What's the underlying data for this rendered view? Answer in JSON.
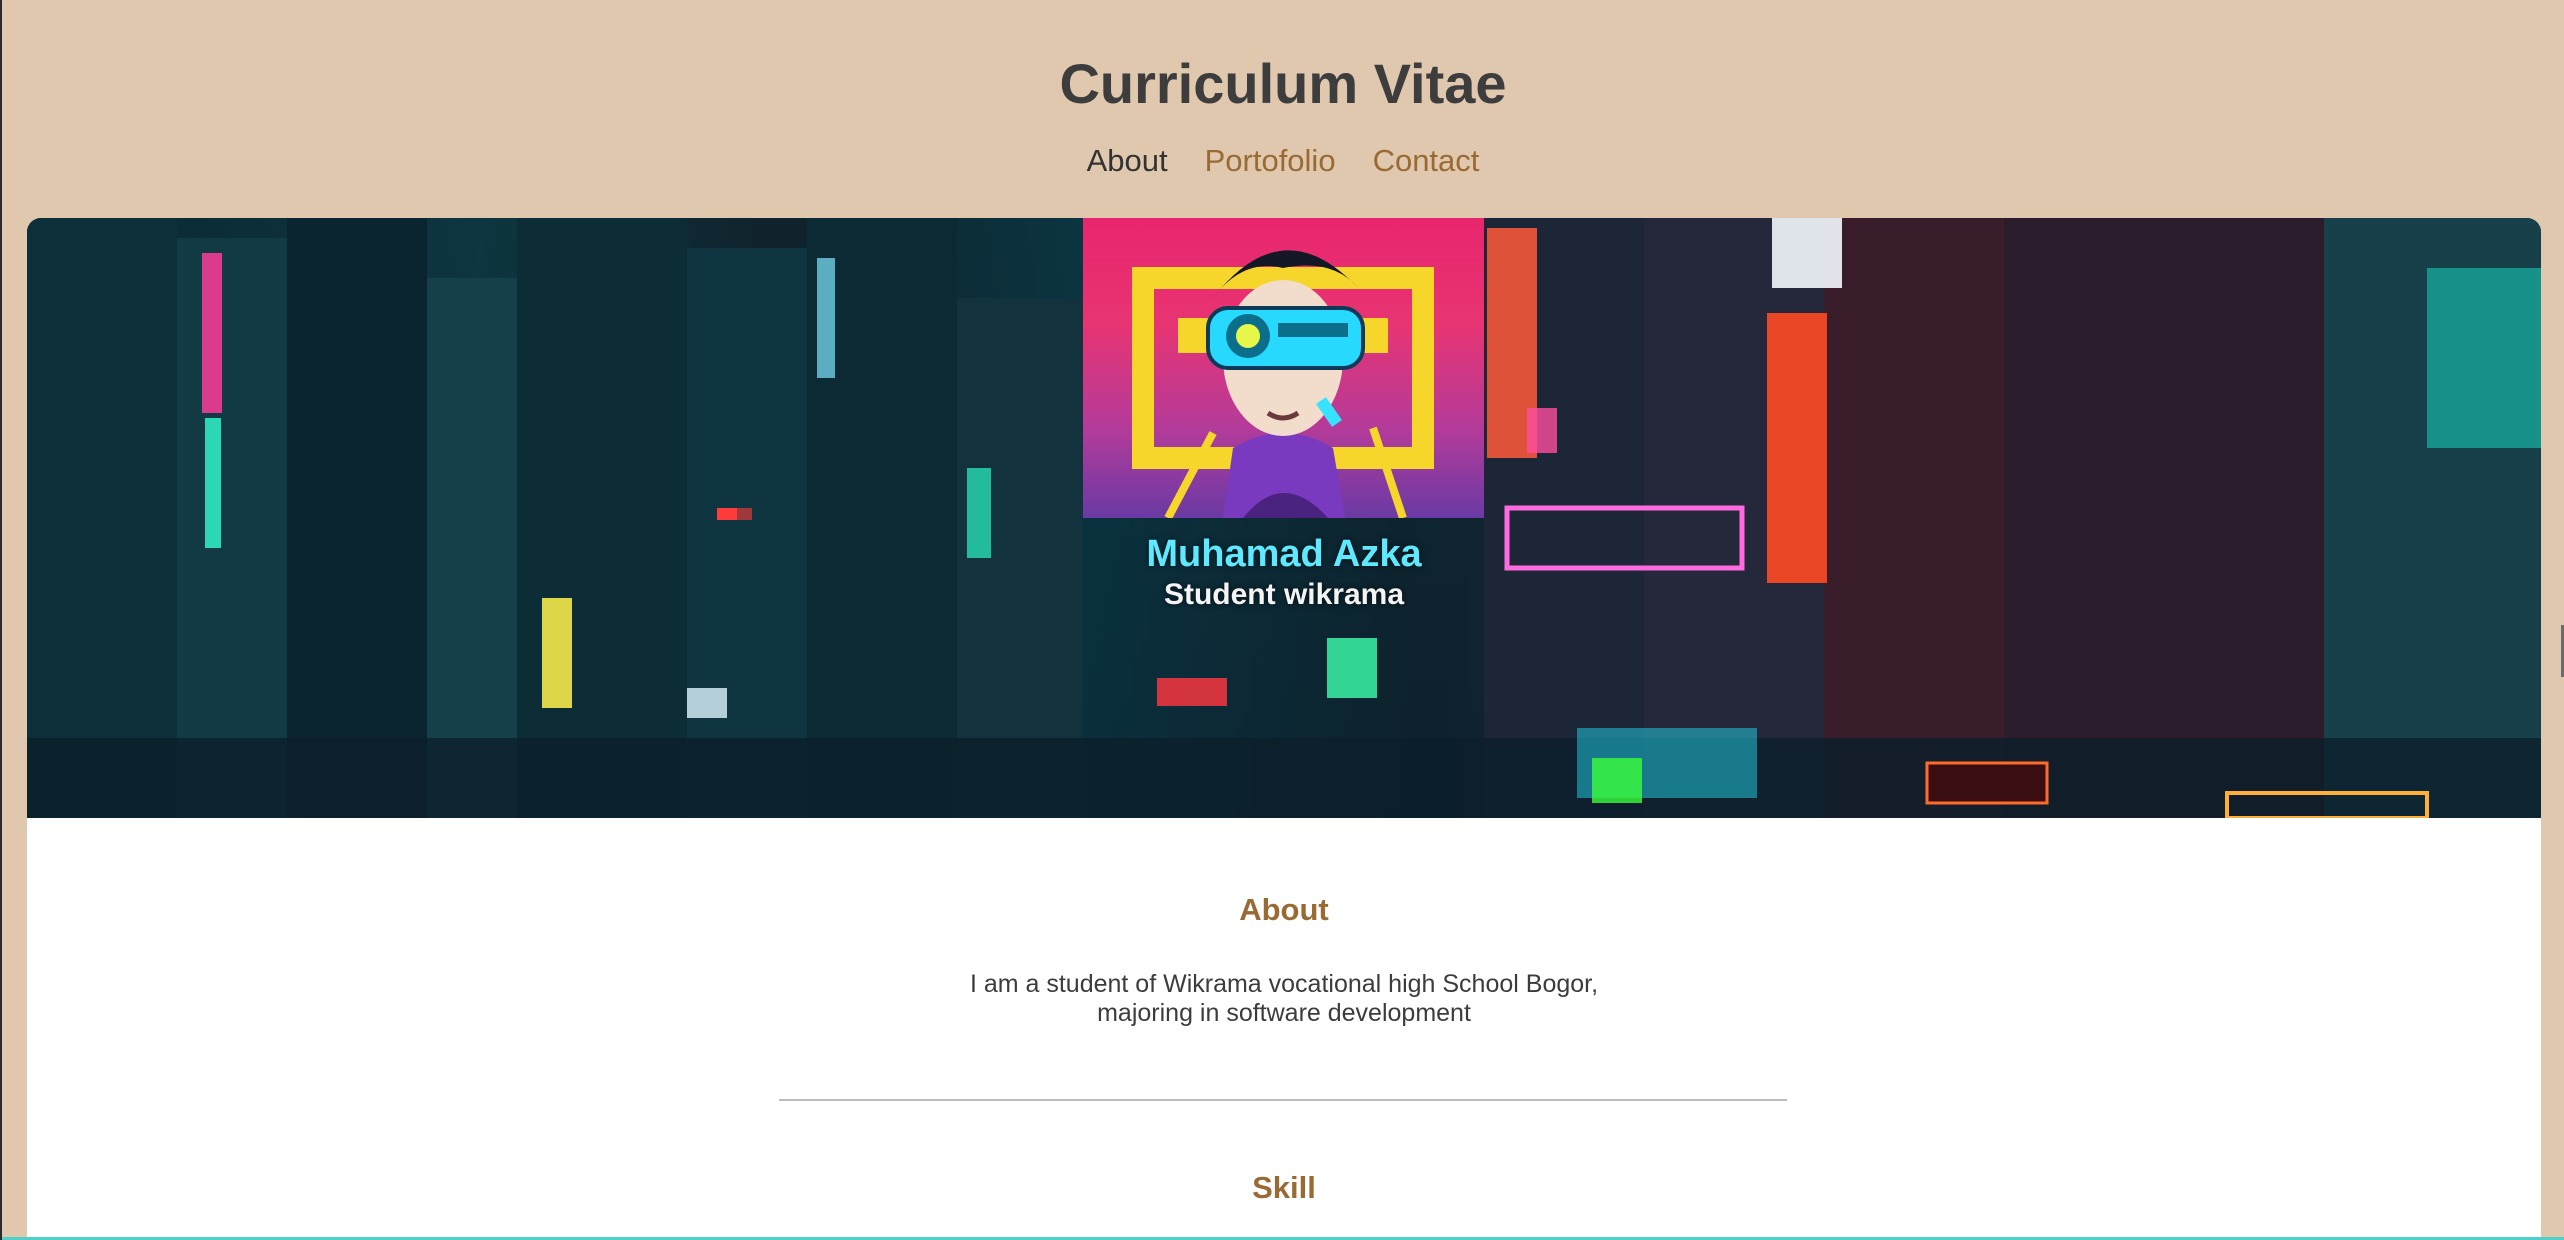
{
  "header": {
    "title": "Curriculum Vitae"
  },
  "nav": {
    "items": [
      {
        "label": "About",
        "active": true
      },
      {
        "label": "Portofolio",
        "active": false
      },
      {
        "label": "Contact",
        "active": false
      }
    ]
  },
  "hero": {
    "name": "Muhamad Azka",
    "role": "Student wikrama",
    "portrait_icon": "cyberpunk-avatar-image",
    "background_icon": "neon-city-street-image"
  },
  "about": {
    "heading": "About",
    "line1": "I am a student of Wikrama vocational high School Bogor,",
    "line2": "majoring in software development"
  },
  "skill": {
    "heading": "Skill"
  },
  "colors": {
    "page_bg": "#dfc8ae",
    "accent": "#9a6a34",
    "title": "#3d3d3d",
    "name_cyan": "#5ee9ff"
  }
}
